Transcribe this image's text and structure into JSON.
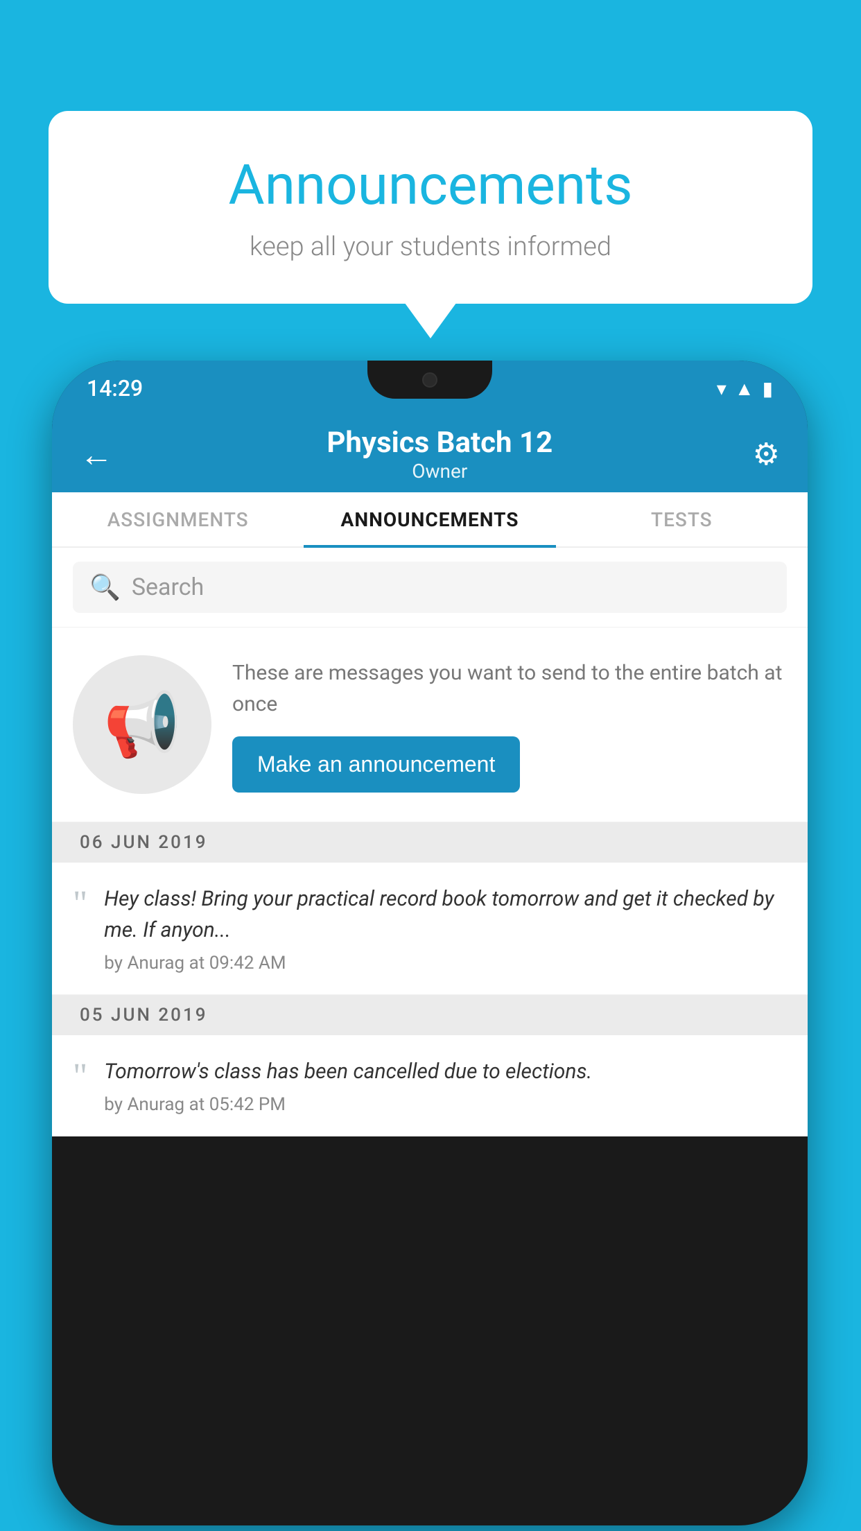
{
  "background_color": "#1ab5e0",
  "speech_bubble": {
    "title": "Announcements",
    "subtitle": "keep all your students informed"
  },
  "phone": {
    "status_bar": {
      "time": "14:29"
    },
    "header": {
      "title": "Physics Batch 12",
      "subtitle": "Owner"
    },
    "tabs": [
      {
        "label": "ASSIGNMENTS",
        "active": false
      },
      {
        "label": "ANNOUNCEMENTS",
        "active": true
      },
      {
        "label": "TESTS",
        "active": false
      }
    ],
    "search": {
      "placeholder": "Search"
    },
    "empty_state": {
      "description": "These are messages you want to send to the entire batch at once",
      "button_label": "Make an announcement"
    },
    "announcements": [
      {
        "date": "06  JUN  2019",
        "text": "Hey class! Bring your practical record book tomorrow and get it checked by me. If anyon...",
        "meta": "by Anurag at 09:42 AM"
      },
      {
        "date": "05  JUN  2019",
        "text": "Tomorrow's class has been cancelled due to elections.",
        "meta": "by Anurag at 05:42 PM"
      }
    ]
  }
}
